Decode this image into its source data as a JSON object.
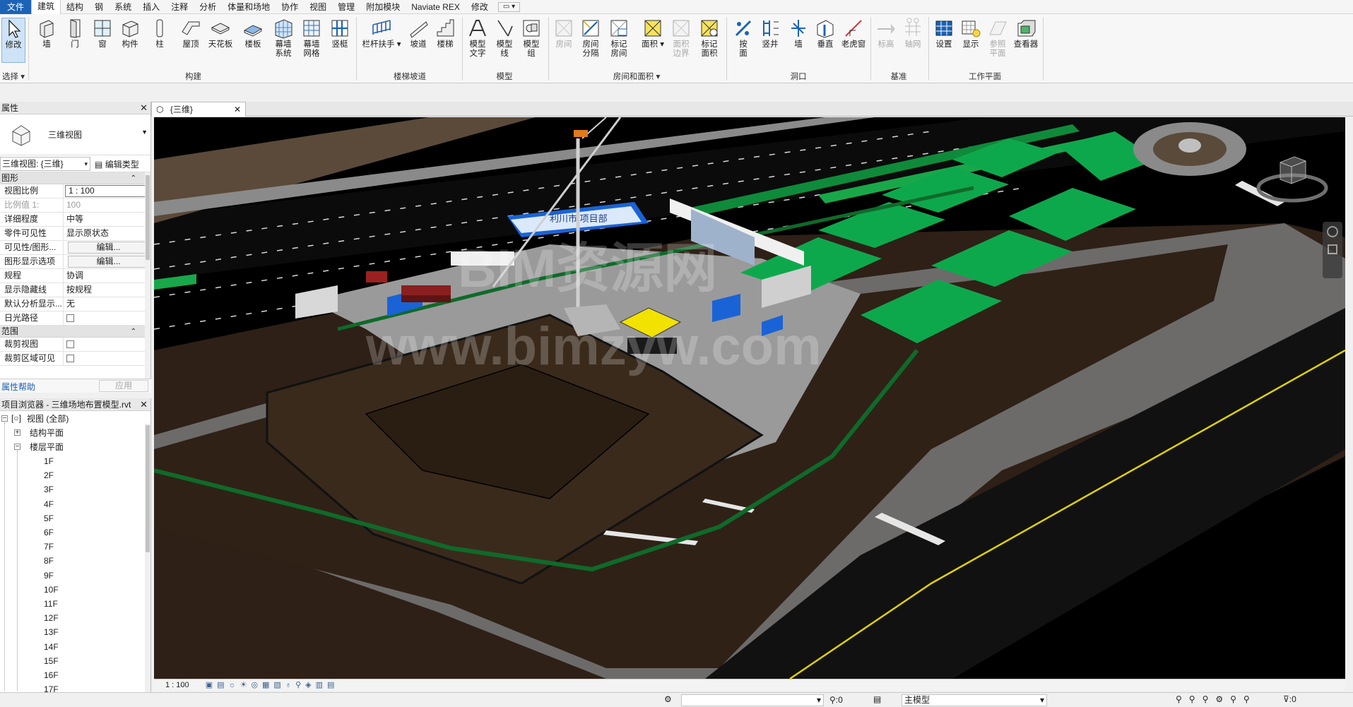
{
  "menu": {
    "file": "文件",
    "tabs": [
      "建筑",
      "结构",
      "钢",
      "系统",
      "插入",
      "注释",
      "分析",
      "体量和场地",
      "协作",
      "视图",
      "管理",
      "附加模块",
      "Naviate REX",
      "修改"
    ],
    "active_tab": "建筑"
  },
  "ribbon": {
    "select": {
      "modify": "修改",
      "group_label": "选择"
    },
    "build": {
      "items": [
        "墙",
        "门",
        "窗",
        "构件",
        "柱",
        "屋顶",
        "天花板",
        "楼板",
        "幕墙\n系统",
        "幕墙\n网格",
        "竖梃"
      ],
      "group_label": "构建"
    },
    "circulation": {
      "items": [
        "栏杆扶手",
        "坡道",
        "楼梯"
      ],
      "group_label": "楼梯坡道"
    },
    "model": {
      "items": [
        "模型\n文字",
        "模型\n线",
        "模型\n组"
      ],
      "group_label": "模型"
    },
    "room": {
      "items": [
        "房间",
        "房间\n分隔",
        "标记\n房间",
        "面积",
        "面积\n边界",
        "标记\n面积"
      ],
      "group_label": "房间和面积"
    },
    "opening": {
      "items": [
        "按\n面",
        "竖井",
        "墙",
        "垂直",
        "老虎窗"
      ],
      "group_label": "洞口"
    },
    "datum": {
      "items": [
        "标高",
        "轴网"
      ],
      "group_label": "基准"
    },
    "workplane": {
      "items": [
        "设置",
        "显示",
        "参照\n平面",
        "查看器"
      ],
      "group_label": "工作平面"
    }
  },
  "properties": {
    "title": "属性",
    "type_name": "三维视图",
    "instance_selector": "三维视图: {三维}",
    "edit_type": "编辑类型",
    "sections": [
      {
        "name": "图形",
        "rows": [
          {
            "k": "视图比例",
            "v": "1 : 100",
            "style": "boxed"
          },
          {
            "k": "比例值 1:",
            "v": "100",
            "style": "grey"
          },
          {
            "k": "详细程度",
            "v": "中等"
          },
          {
            "k": "零件可见性",
            "v": "显示原状态"
          },
          {
            "k": "可见性/图形...",
            "v": "编辑...",
            "style": "button"
          },
          {
            "k": "图形显示选项",
            "v": "编辑...",
            "style": "button"
          },
          {
            "k": "规程",
            "v": "协调"
          },
          {
            "k": "显示隐藏线",
            "v": "按规程"
          },
          {
            "k": "默认分析显示...",
            "v": "无"
          },
          {
            "k": "日光路径",
            "v": "",
            "style": "check"
          }
        ]
      },
      {
        "name": "范围",
        "rows": [
          {
            "k": "裁剪视图",
            "v": "",
            "style": "check"
          },
          {
            "k": "裁剪区域可见",
            "v": "",
            "style": "check"
          }
        ]
      }
    ],
    "help": "属性帮助",
    "apply": "应用"
  },
  "browser": {
    "title": "项目浏览器 - 三维场地布置模型.rvt",
    "root": "视图 (全部)",
    "structural": "结构平面",
    "floor": "楼层平面",
    "levels": [
      "1F",
      "2F",
      "3F",
      "4F",
      "5F",
      "6F",
      "7F",
      "8F",
      "9F",
      "10F",
      "11F",
      "12F",
      "13F",
      "14F",
      "15F",
      "16F",
      "17F"
    ]
  },
  "view": {
    "tab_title": "{三维}",
    "scale": "1 : 100",
    "sign_text": "利川市 项目部",
    "watermark_1": "BIM资源网",
    "watermark_2": "www.bimzyw.com"
  },
  "status": {
    "counter_1": ":0",
    "model": "主模型",
    "filter": ":0"
  },
  "colors": {
    "accent": "#1c63b7",
    "ground_dark": "#2e2016",
    "pavement": "#7c7c7c",
    "road": "#121212",
    "grass": "#0ea84c",
    "fence": "#0f6a2a",
    "blue_building": "#1a63d6",
    "yellow_roof": "#f2e200"
  }
}
